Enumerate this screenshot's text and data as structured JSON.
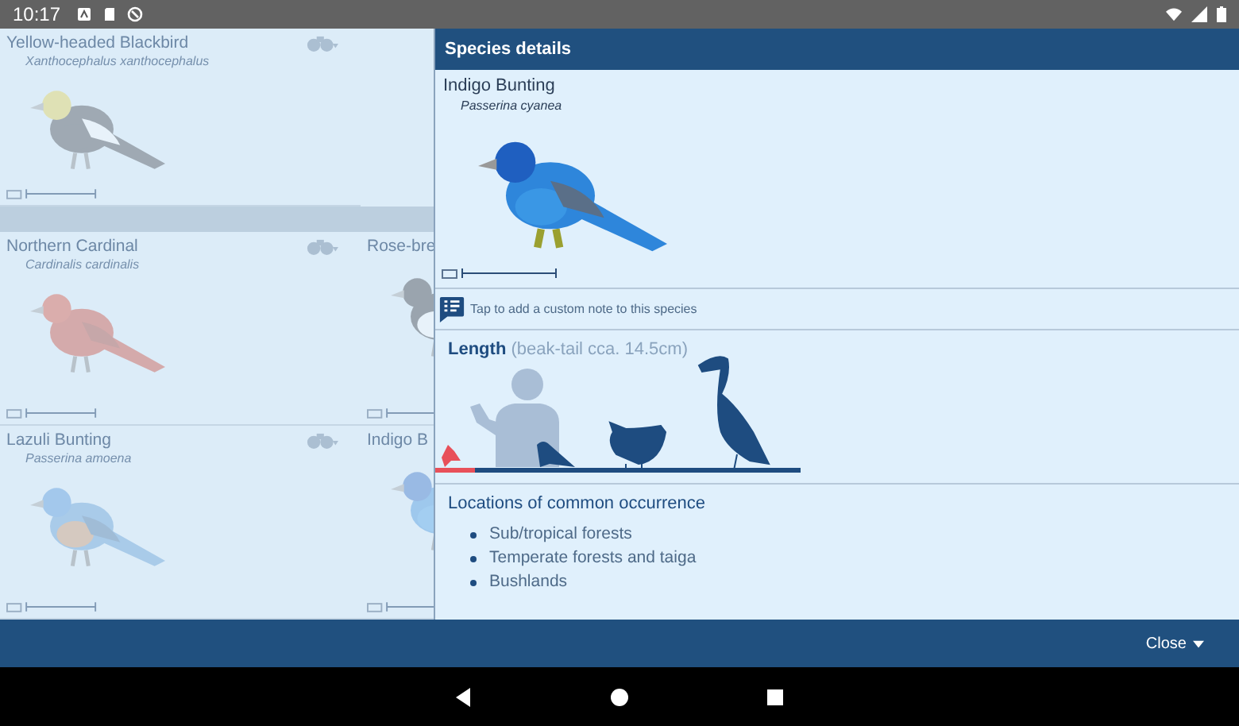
{
  "status_bar": {
    "time": "10:17"
  },
  "species_list": {
    "groups": [
      {
        "cards": [
          {
            "name": "Yellow-headed Blackbird",
            "scientific": "Xanthocephalus xanthocephalus",
            "kind": "blackbird"
          }
        ]
      },
      {
        "cards": [
          {
            "name": "Northern Cardinal",
            "scientific": "Cardinalis cardinalis",
            "kind": "cardinal"
          },
          {
            "name": "Rose-bre",
            "kind": "grosbeak"
          },
          {
            "name": "Lazuli Bunting",
            "scientific": "Passerina amoena",
            "kind": "lazuli"
          },
          {
            "name": "Indigo B",
            "kind": "indigo"
          }
        ]
      }
    ]
  },
  "details": {
    "title": "Species details",
    "name": "Indigo Bunting",
    "scientific": "Passerina cyanea",
    "kind": "indigo",
    "note": "Tap to add a custom note to this species",
    "length": "**Length** (beak-tail cca. 14.5cm)",
    "locations_heading": "Locations of common occurrence",
    "locations": [
      "Sub/tropical forests",
      "Temperate forests and taiga",
      "Bushlands"
    ]
  },
  "bottom_bar": {
    "close": "Close"
  }
}
